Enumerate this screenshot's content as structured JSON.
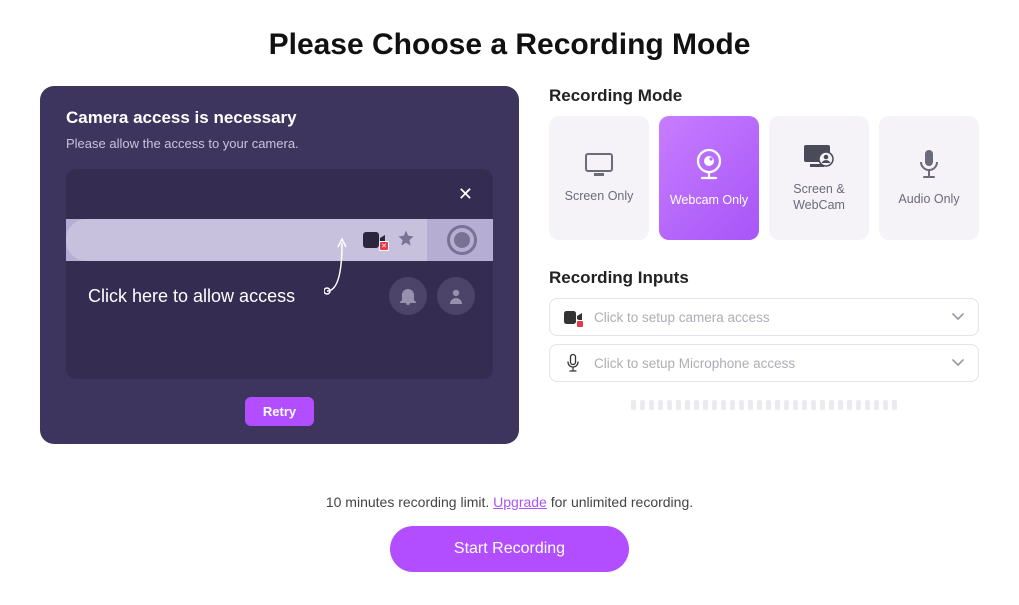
{
  "title": "Please Choose a Recording Mode",
  "camera_panel": {
    "heading": "Camera access is necessary",
    "subtext": "Please allow the access to your camera.",
    "hint": "Click here to allow access",
    "retry_label": "Retry"
  },
  "mode_section": {
    "title": "Recording Mode",
    "cards": {
      "screen": "Screen Only",
      "webcam": "Webcam Only",
      "both": "Screen & WebCam",
      "audio": "Audio Only"
    }
  },
  "inputs_section": {
    "title": "Recording Inputs",
    "camera_text": "Click to setup camera access",
    "mic_text": "Click to setup Microphone access"
  },
  "footer": {
    "limit_before": "10 minutes recording limit. ",
    "upgrade": "Upgrade",
    "limit_after": " for unlimited recording.",
    "start_label": "Start Recording"
  }
}
